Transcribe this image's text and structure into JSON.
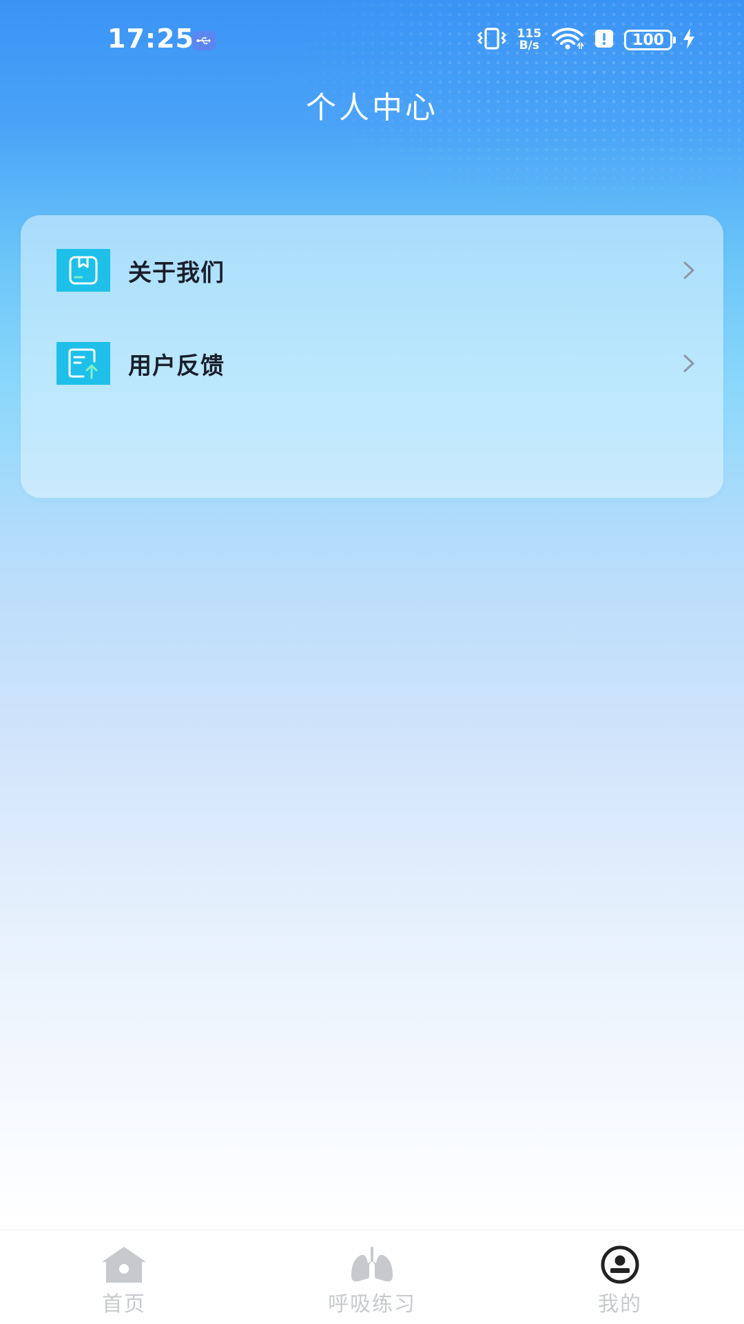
{
  "status_bar": {
    "time": "17:25",
    "net_speed_value": "115",
    "net_speed_unit": "B/s",
    "battery": "100"
  },
  "header": {
    "title": "个人中心"
  },
  "menu": {
    "items": [
      {
        "label": "关于我们",
        "icon": "bookmark-doc-icon"
      },
      {
        "label": "用户反馈",
        "icon": "upload-doc-icon"
      }
    ]
  },
  "tab_bar": {
    "tabs": [
      {
        "label": "首页",
        "icon": "home-icon"
      },
      {
        "label": "呼吸练习",
        "icon": "lungs-icon"
      },
      {
        "label": "我的",
        "icon": "profile-icon",
        "active": true
      }
    ]
  },
  "colors": {
    "accent": "#1ec0ea",
    "header_blue": "#3b93f5",
    "tab_inactive": "#c7c9cd",
    "tab_active_icon": "#222222"
  }
}
